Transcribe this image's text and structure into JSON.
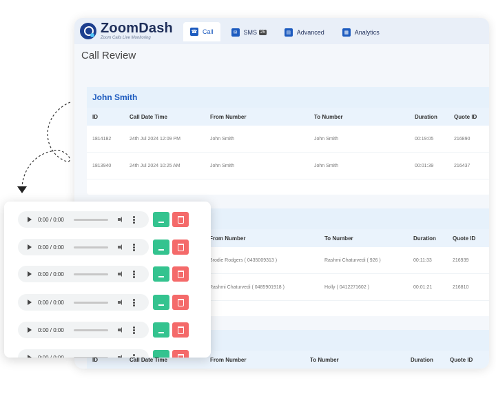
{
  "app": {
    "brand": "ZoomDash",
    "tagline": "Zoom Calls Live Monitoring",
    "tabs": [
      {
        "label": "Call",
        "icon": "phone-icon"
      },
      {
        "label": "SMS",
        "icon": "message-icon",
        "badge": "25"
      },
      {
        "label": "Advanced",
        "icon": "chart-icon"
      },
      {
        "label": "Analytics",
        "icon": "document-icon"
      }
    ],
    "page_title": "Call Review"
  },
  "card1": {
    "title": "John Smith",
    "headers": [
      "ID",
      "Call Date Time",
      "From Number",
      "To Number",
      "Duration",
      "Quote ID"
    ],
    "rows": [
      [
        "1814182",
        "24th Jul 2024 12:09 PM",
        "John Smith",
        "John Smith",
        "00:19:05",
        "216890"
      ],
      [
        "1813940",
        "24th Jul 2024 10:25 AM",
        "John Smith",
        "John Smith",
        "00:01:39",
        "216437"
      ]
    ]
  },
  "card2": {
    "headers": [
      "From Number",
      "To Number",
      "Duration",
      "Quote ID"
    ],
    "rows": [
      [
        "Brodie Rodgers ( 0435009313 )",
        "Rashmi Chaturvedi ( 926 )",
        "00:11:33",
        "216939"
      ],
      [
        "Rashmi Chaturvedi ( 0485901918 )",
        "Holly ( 0412271602 )",
        "00:01:21",
        "216810"
      ]
    ]
  },
  "card3": {
    "headers": [
      "ID",
      "Call Date Time",
      "From Number",
      "To Number",
      "Duration",
      "Quote ID"
    ]
  },
  "player": {
    "time": "0:00 / 0:00"
  },
  "colors": {
    "accent": "#1d5bbf",
    "download": "#34c38f",
    "delete": "#f46a6a"
  }
}
